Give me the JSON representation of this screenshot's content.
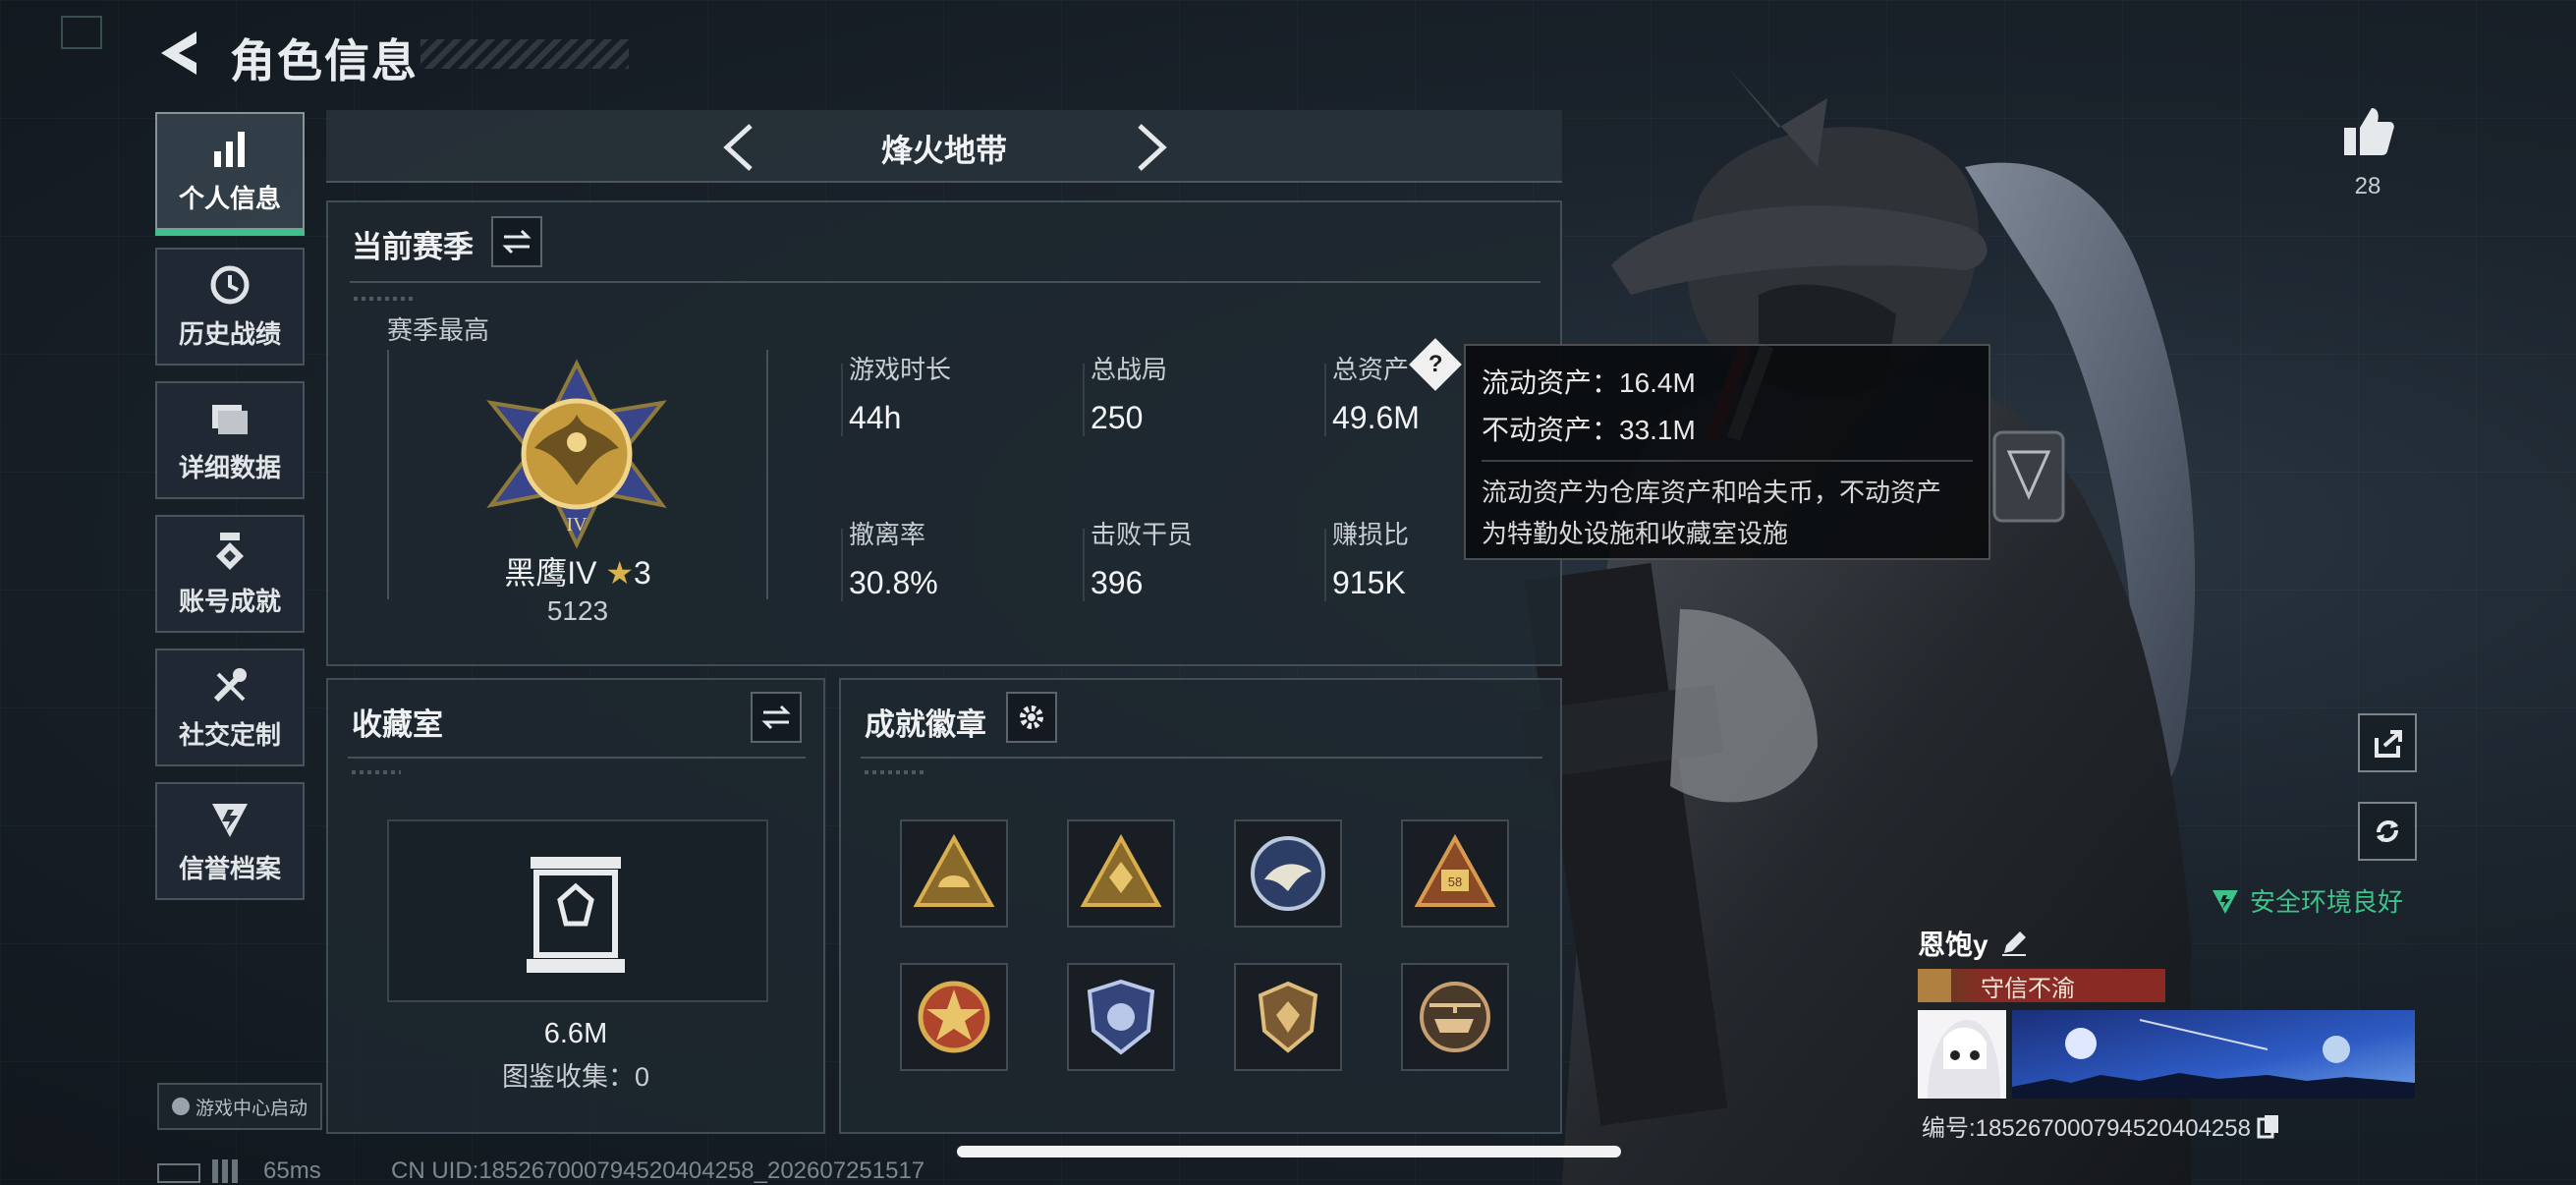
{
  "header": {
    "title": "角色信息"
  },
  "nav": {
    "items": [
      {
        "label": "个人信息",
        "icon": "bar-chart-icon",
        "active": true
      },
      {
        "label": "历史战绩",
        "icon": "history-clock-icon",
        "active": false
      },
      {
        "label": "详细数据",
        "icon": "folder-data-icon",
        "active": false
      },
      {
        "label": "账号成就",
        "icon": "achievement-medal-icon",
        "active": false
      },
      {
        "label": "社交定制",
        "icon": "wrench-customize-icon",
        "active": false
      },
      {
        "label": "信誉档案",
        "icon": "credit-shield-icon",
        "active": false
      }
    ],
    "game_center": "游戏中心启动"
  },
  "map_selector": {
    "name": "烽火地带"
  },
  "season": {
    "title": "当前赛季",
    "best_label": "赛季最高",
    "rank_name": "黑鹰IV",
    "rank_stars": "3",
    "rank_score": "5123",
    "stats": [
      {
        "label": "游戏时长",
        "value": "44h"
      },
      {
        "label": "总战局",
        "value": "250"
      },
      {
        "label": "总资产",
        "value": "49.6M"
      },
      {
        "label": "撤离率",
        "value": "30.8%"
      },
      {
        "label": "击败干员",
        "value": "396"
      },
      {
        "label": "赚损比",
        "value": "915K"
      }
    ]
  },
  "tooltip": {
    "liquid": "流动资产：16.4M",
    "fixed": "不动资产：33.1M",
    "desc_line1": "流动资产为仓库资产和哈夫币，不动资产",
    "desc_line2": "为特勤处设施和收藏室设施"
  },
  "collection": {
    "title": "收藏室",
    "value": "6.6M",
    "catalog": "图鉴收集：0"
  },
  "achievements": {
    "title": "成就徽章",
    "badges": [
      {
        "icon": "triangle-helmet-badge-icon",
        "color": "#c89a3c"
      },
      {
        "icon": "triangle-crest-badge-icon",
        "color": "#c89a3c"
      },
      {
        "icon": "eagle-round-badge-icon",
        "color": "#9fb4d0"
      },
      {
        "icon": "triangle-vehicle-badge-icon",
        "color": "#c89a3c"
      },
      {
        "icon": "star-medal-badge-icon",
        "color": "#c4573c"
      },
      {
        "icon": "police-shield-badge-icon",
        "color": "#8ea4d6"
      },
      {
        "icon": "shield-crest-badge-icon",
        "color": "#c8a060"
      },
      {
        "icon": "helicopter-badge-icon",
        "color": "#b89466"
      }
    ]
  },
  "likes": {
    "count": "28"
  },
  "player": {
    "safe_env": "安全环境良好",
    "name": "恩饱y",
    "credit_tag": "守信不渝",
    "id_line": "编号:18526700079452040425​8"
  },
  "footer": {
    "ping": "65ms",
    "uid": "CN UID:18526700079452040425​8_202607251517"
  },
  "colors": {
    "accent_green": "#3ec28a",
    "credit_red": "#8a2a24",
    "gold": "#c89a3c"
  }
}
